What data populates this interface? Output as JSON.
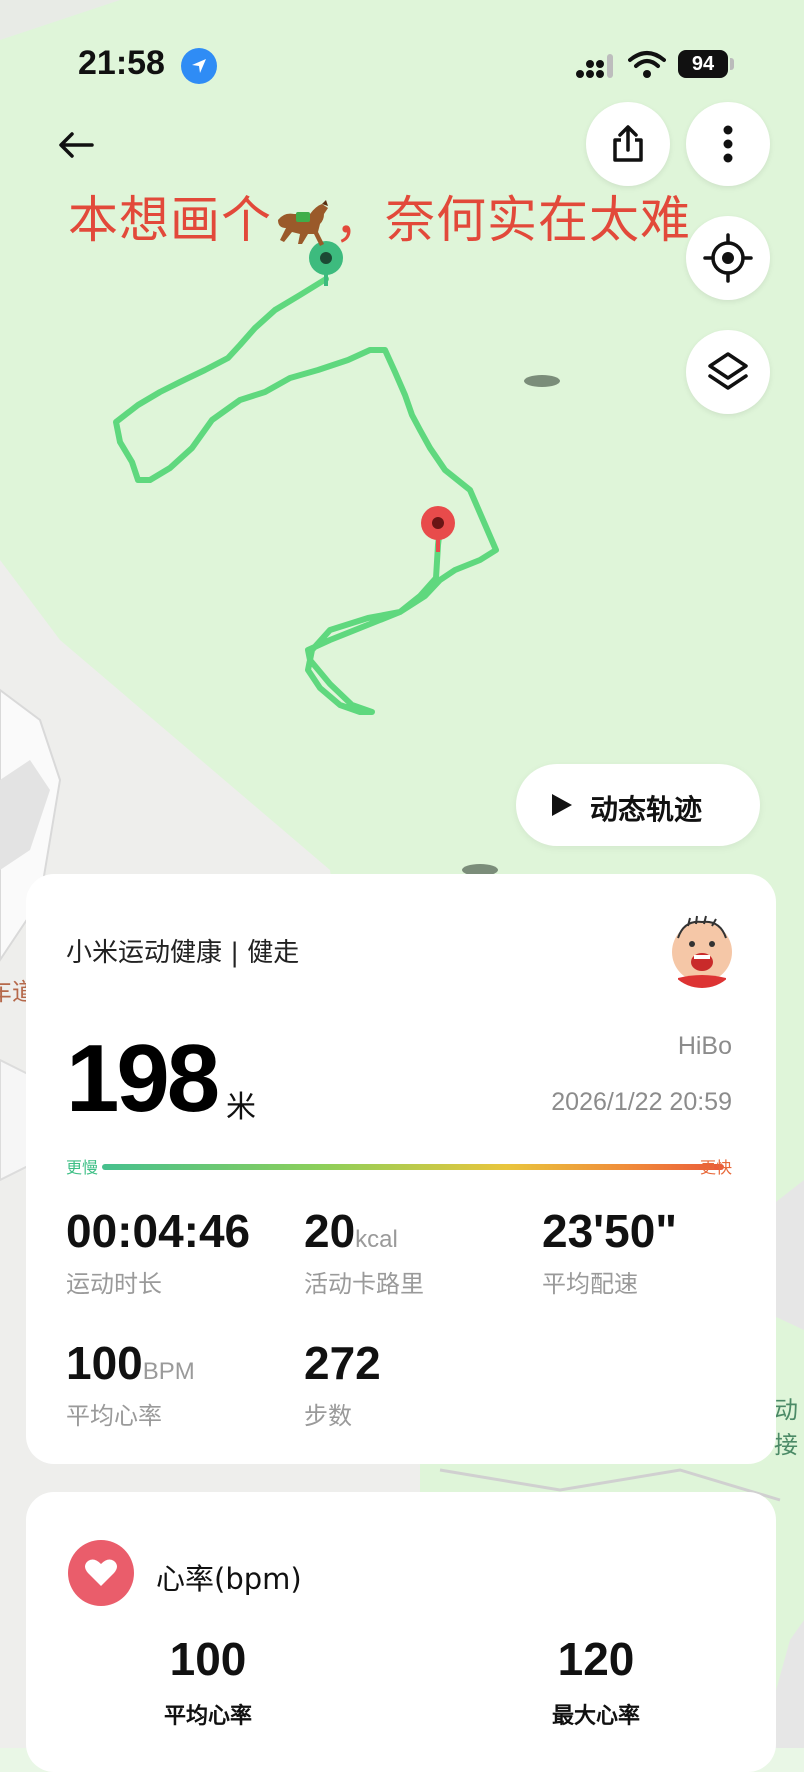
{
  "status_bar": {
    "time": "21:58",
    "battery": "94"
  },
  "overlay": {
    "caption_before": "本想画个",
    "caption_after": "，奈何实在太难"
  },
  "map": {
    "track_color": "#5fd87e",
    "start_color": "#3dbb7e",
    "end_color": "#e84b4b",
    "road_label_left": "车道",
    "road_label_right": "动接"
  },
  "replay": {
    "label": "动态轨迹"
  },
  "summary": {
    "brand": "小米运动健康 | 健走",
    "distance": "198",
    "distance_unit": "米",
    "user": "HiBo",
    "datetime": "2026/1/22 20:59",
    "slower": "更慢",
    "faster": "更快",
    "stats": [
      {
        "value": "00:04:46",
        "unit": "",
        "label": "运动时长"
      },
      {
        "value": "20",
        "unit": "kcal",
        "label": "活动卡路里"
      },
      {
        "value": "23'50\"",
        "unit": "",
        "label": "平均配速"
      },
      {
        "value": "100",
        "unit": "BPM",
        "label": "平均心率"
      },
      {
        "value": "272",
        "unit": "",
        "label": "步数"
      }
    ]
  },
  "heart_rate": {
    "title": "心率(bpm)",
    "avg_value": "100",
    "avg_label": "平均心率",
    "max_value": "120",
    "max_label": "最大心率"
  },
  "icons": [
    "back-arrow-icon",
    "share-icon",
    "more-icon",
    "locate-icon",
    "layers-icon",
    "play-icon",
    "heart-icon",
    "location-arrow-icon",
    "signal-icon",
    "wifi-icon"
  ]
}
